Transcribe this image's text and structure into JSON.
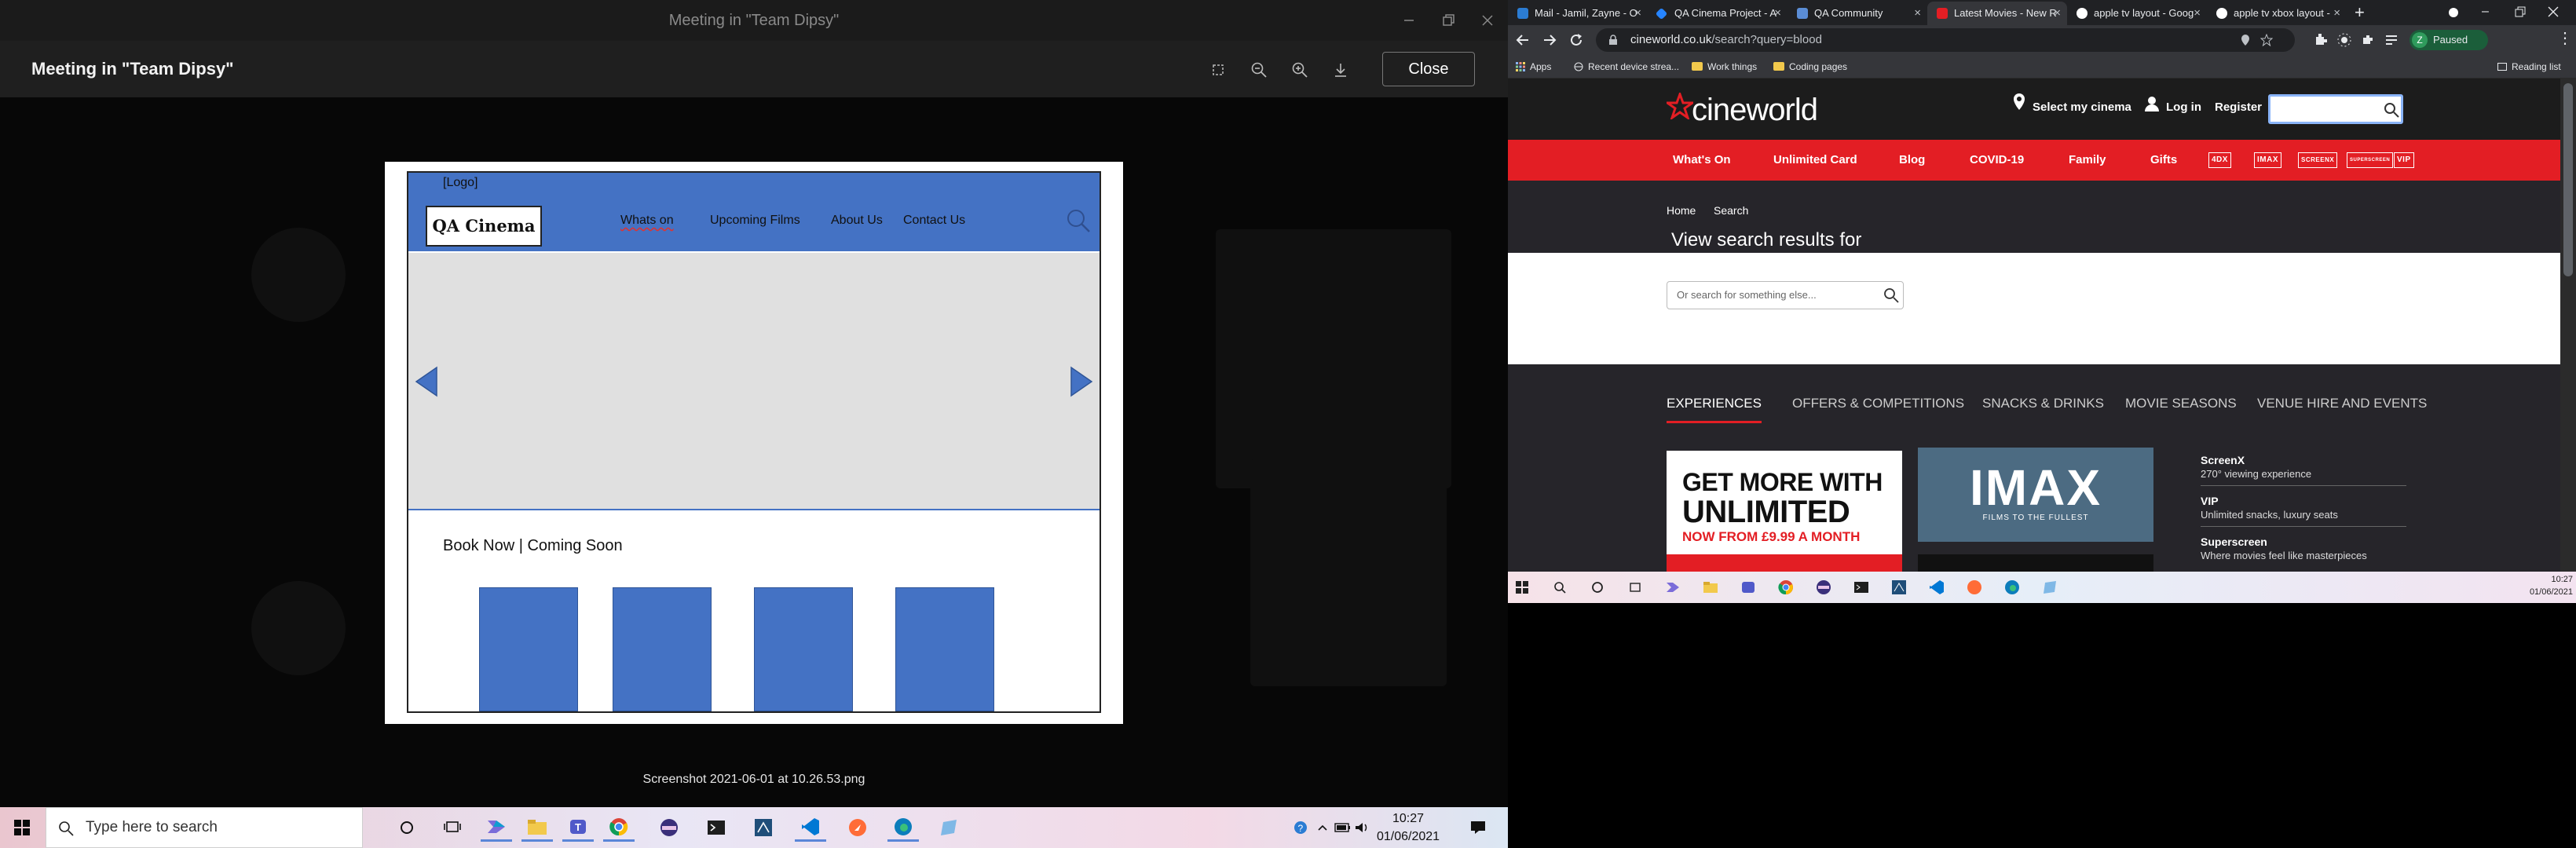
{
  "teams": {
    "window_title": "Meeting in \"Team Dipsy\"",
    "viewer_title": "Meeting in \"Team Dipsy\"",
    "close_label": "Close",
    "caption": "Screenshot 2021-06-01 at 10.26.53.png",
    "wireframe": {
      "logo_note": "[Logo]",
      "logo_text": "QA Cinema",
      "nav": [
        "Whats on",
        "Upcoming Films",
        "About Us",
        "Contact Us"
      ],
      "lower_title": "Book Now | Coming Soon"
    }
  },
  "chrome": {
    "tabs": [
      {
        "title": "Mail - Jamil, Zayne - O",
        "color": "#2b7cd3"
      },
      {
        "title": "QA Cinema Project - A",
        "color": "#2684ff"
      },
      {
        "title": "QA Community",
        "color": "#5b8dd6"
      },
      {
        "title": "Latest Movies - New R",
        "color": "#e31e24"
      },
      {
        "title": "apple tv layout - Goog",
        "color": "#ffffff"
      },
      {
        "title": "apple tv xbox layout -",
        "color": "#ffffff"
      }
    ],
    "url_host": "cineworld.co.uk",
    "url_path": "/search?query=blood",
    "paused_label": "Paused",
    "profile_letter": "Z",
    "bookmarks": [
      "Apps",
      "Recent device strea...",
      "Work things",
      "Coding pages"
    ],
    "reading_list": "Reading list"
  },
  "cineworld": {
    "logo": "cineworld",
    "select_cinema": "Select my cinema",
    "login": "Log in",
    "register": "Register",
    "nav": [
      "What's On",
      "Unlimited Card",
      "Blog",
      "COVID-19",
      "Family",
      "Gifts"
    ],
    "brands": [
      "4DX",
      "IMAX",
      "SCREENX",
      "SUPERSCREEN",
      "VIP"
    ],
    "breadcrumb": [
      "Home",
      "Search"
    ],
    "results_heading": "View search results for",
    "search_placeholder": "Or search for something else...",
    "exp_tabs": [
      "EXPERIENCES",
      "OFFERS & COMPETITIONS",
      "SNACKS & DRINKS",
      "MOVIE SEASONS",
      "VENUE HIRE AND EVENTS"
    ],
    "promo1": [
      "GET MORE WITH",
      "UNLIMITED",
      "NOW FROM £9.99 A MONTH"
    ],
    "promo2": {
      "title": "IMAX",
      "tag": "FILMS TO THE FULLEST"
    },
    "experiences": [
      {
        "name": "ScreenX",
        "desc": "270° viewing experience"
      },
      {
        "name": "VIP",
        "desc": "Unlimited snacks, luxury seats"
      },
      {
        "name": "Superscreen",
        "desc": "Where movies feel like masterpieces"
      }
    ]
  },
  "small_taskbar": {
    "time": "10:27",
    "date": "01/06/2021"
  },
  "taskbar": {
    "search_placeholder": "Type here to search",
    "time": "10:27",
    "date": "01/06/2021"
  }
}
